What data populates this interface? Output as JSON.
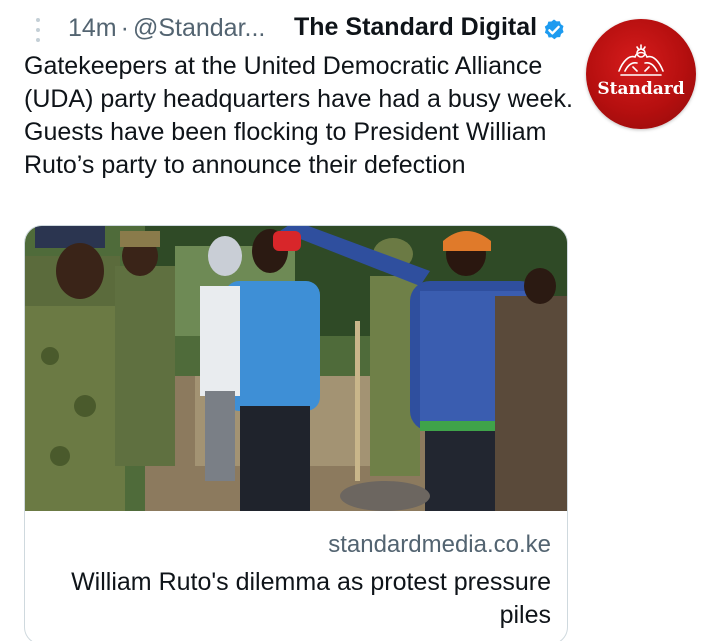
{
  "tweet": {
    "timestamp": "14m",
    "separator": "·",
    "handle": "@Standar...",
    "display_name": "The Standard Digital",
    "verified": true,
    "text": "Gatekeepers at the United Democratic Alliance (UDA) party headquarters have had a busy week. Guests have been flocking to President William Ruto’s party to announce their defection"
  },
  "avatar": {
    "brand_text": "Standard",
    "icon": "standard-crest-logo"
  },
  "card": {
    "image_icon": "protest-crowd-photo",
    "domain": "standardmedia.co.ke",
    "title": "William Ruto's dilemma as protest pressure piles"
  },
  "colors": {
    "verified_blue": "#1d9bf0",
    "muted_text": "#536471",
    "brand_red": "#c41212",
    "border": "#cfd9de"
  }
}
